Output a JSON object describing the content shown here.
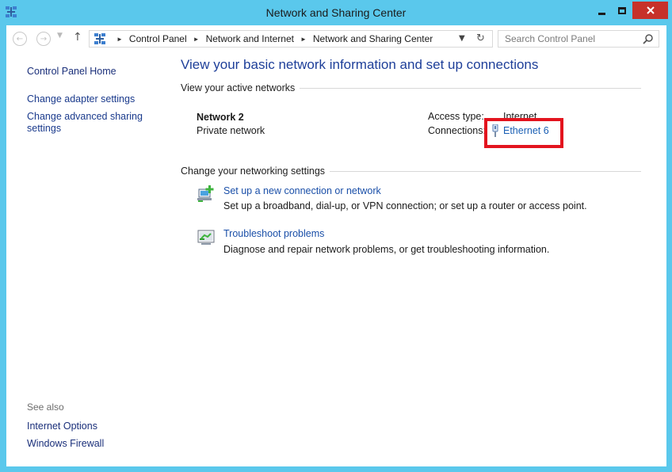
{
  "window": {
    "title": "Network and Sharing Center",
    "app_icon": "network-icon",
    "controls": [
      "minimize",
      "maximize",
      "close"
    ],
    "close_color": "#c7312a",
    "frame_color": "#5ac8ec"
  },
  "navigation": {
    "back_icon": "back-arrow-icon",
    "forward_icon": "forward-arrow-icon",
    "up_icon": "up-arrow-icon",
    "breadcrumb": [
      "Control Panel",
      "Network and Internet",
      "Network and Sharing Center"
    ],
    "search_placeholder": "Search Control Panel"
  },
  "sidebar": {
    "home": "Control Panel Home",
    "links": [
      "Change adapter settings",
      "Change advanced sharing settings"
    ],
    "see_also_label": "See also",
    "see_also": [
      "Internet Options",
      "Windows Firewall"
    ]
  },
  "main": {
    "title": "View your basic network information and set up connections",
    "active_networks_label": "View your active networks",
    "network": {
      "name": "Network  2",
      "type": "Private network",
      "access_type_label": "Access type:",
      "access_type_value": "Internet",
      "connections_label": "Connections:",
      "connection_name": "Ethernet 6"
    },
    "change_settings_label": "Change your networking settings",
    "tasks": [
      {
        "label": "Set up a new connection or network",
        "description": "Set up a broadband, dial-up, or VPN connection; or set up a router or access point.",
        "icon": "new-connection-icon"
      },
      {
        "label": "Troubleshoot problems",
        "description": "Diagnose and repair network problems, or get troubleshooting information.",
        "icon": "troubleshoot-icon"
      }
    ],
    "highlight_color": "#e3141e"
  }
}
